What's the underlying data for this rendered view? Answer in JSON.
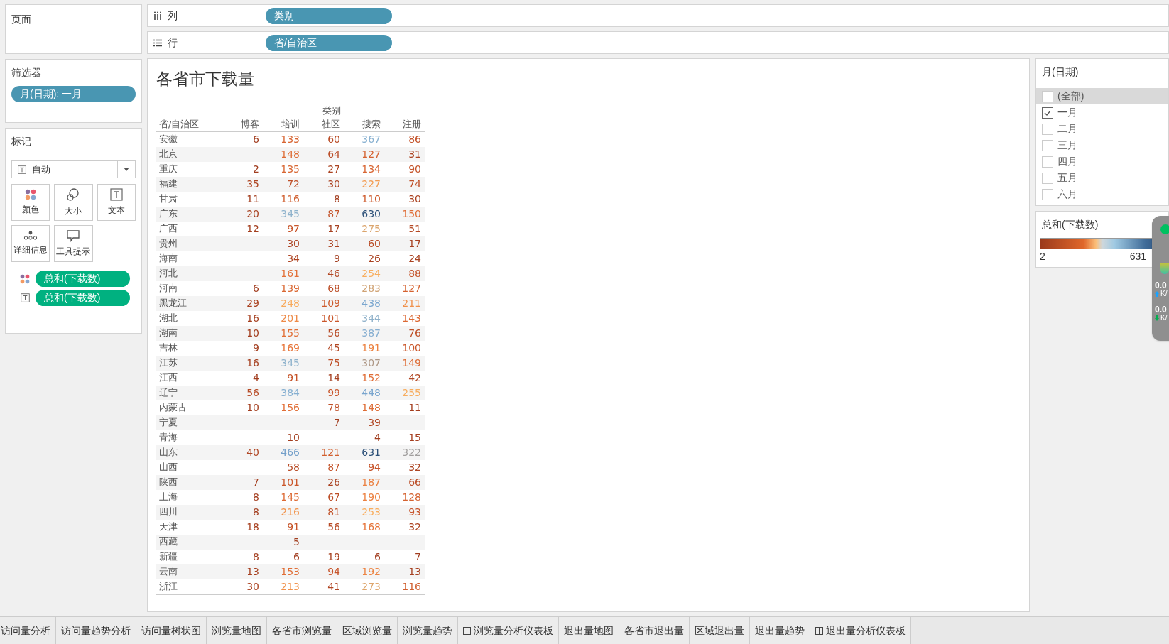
{
  "pages_card": {
    "title": "页面"
  },
  "shelves": [
    {
      "kind": "columns",
      "label": "列",
      "pill": "类别"
    },
    {
      "kind": "rows",
      "label": "行",
      "pill": "省/自治区"
    }
  ],
  "filters_card": {
    "title": "筛选器",
    "pills": [
      "月(日期): 一月"
    ]
  },
  "marks_card": {
    "title": "标记",
    "mark_type": "自动",
    "buttons": [
      {
        "kind": "color",
        "label": "颜色"
      },
      {
        "kind": "size",
        "label": "大小"
      },
      {
        "kind": "text",
        "label": "文本"
      },
      {
        "kind": "detail",
        "label": "详细信息"
      },
      {
        "kind": "tooltip",
        "label": "工具提示"
      }
    ],
    "pills": [
      {
        "kind": "color",
        "label": "总和(下载数)"
      },
      {
        "kind": "text",
        "label": "总和(下载数)"
      }
    ]
  },
  "view": {
    "title": "各省市下载量",
    "column_group": "类别",
    "row_header": "省/自治区",
    "columns": [
      "博客",
      "培训",
      "社区",
      "搜索",
      "注册"
    ],
    "rows": [
      {
        "name": "安徽",
        "values": [
          {
            "value": "6"
          },
          {
            "value": "133"
          },
          {
            "value": "60"
          },
          {
            "value": "367"
          },
          {
            "value": "86"
          }
        ]
      },
      {
        "name": "北京",
        "values": [
          {
            "empty": true
          },
          {
            "value": "148"
          },
          {
            "value": "64"
          },
          {
            "value": "127"
          },
          {
            "value": "31"
          }
        ]
      },
      {
        "name": "重庆",
        "values": [
          {
            "value": "2"
          },
          {
            "value": "135"
          },
          {
            "value": "27"
          },
          {
            "value": "134"
          },
          {
            "value": "90"
          }
        ]
      },
      {
        "name": "福建",
        "values": [
          {
            "value": "35"
          },
          {
            "value": "72"
          },
          {
            "value": "30"
          },
          {
            "value": "227"
          },
          {
            "value": "74"
          }
        ]
      },
      {
        "name": "甘肃",
        "values": [
          {
            "value": "11"
          },
          {
            "value": "116"
          },
          {
            "value": "8"
          },
          {
            "value": "110"
          },
          {
            "value": "30"
          }
        ]
      },
      {
        "name": "广东",
        "values": [
          {
            "value": "20"
          },
          {
            "value": "345"
          },
          {
            "value": "87"
          },
          {
            "value": "630"
          },
          {
            "value": "150"
          }
        ]
      },
      {
        "name": "广西",
        "values": [
          {
            "value": "12"
          },
          {
            "value": "97"
          },
          {
            "value": "17"
          },
          {
            "value": "275"
          },
          {
            "value": "51"
          }
        ]
      },
      {
        "name": "贵州",
        "values": [
          {
            "empty": true
          },
          {
            "value": "30"
          },
          {
            "value": "31"
          },
          {
            "value": "60"
          },
          {
            "value": "17"
          }
        ]
      },
      {
        "name": "海南",
        "values": [
          {
            "empty": true
          },
          {
            "value": "34"
          },
          {
            "value": "9"
          },
          {
            "value": "26"
          },
          {
            "value": "24"
          }
        ]
      },
      {
        "name": "河北",
        "values": [
          {
            "empty": true
          },
          {
            "value": "161"
          },
          {
            "value": "46"
          },
          {
            "value": "254"
          },
          {
            "value": "88"
          }
        ]
      },
      {
        "name": "河南",
        "values": [
          {
            "value": "6"
          },
          {
            "value": "139"
          },
          {
            "value": "68"
          },
          {
            "value": "283"
          },
          {
            "value": "127"
          }
        ]
      },
      {
        "name": "黑龙江",
        "values": [
          {
            "value": "29"
          },
          {
            "value": "248"
          },
          {
            "value": "109"
          },
          {
            "value": "438"
          },
          {
            "value": "211"
          }
        ]
      },
      {
        "name": "湖北",
        "values": [
          {
            "value": "16"
          },
          {
            "value": "201"
          },
          {
            "value": "101"
          },
          {
            "value": "344"
          },
          {
            "value": "143"
          }
        ]
      },
      {
        "name": "湖南",
        "values": [
          {
            "value": "10"
          },
          {
            "value": "155"
          },
          {
            "value": "56"
          },
          {
            "value": "387"
          },
          {
            "value": "76"
          }
        ]
      },
      {
        "name": "吉林",
        "values": [
          {
            "value": "9"
          },
          {
            "value": "169"
          },
          {
            "value": "45"
          },
          {
            "value": "191"
          },
          {
            "value": "100"
          }
        ]
      },
      {
        "name": "江苏",
        "values": [
          {
            "value": "16"
          },
          {
            "value": "345"
          },
          {
            "value": "75"
          },
          {
            "value": "307"
          },
          {
            "value": "149"
          }
        ]
      },
      {
        "name": "江西",
        "values": [
          {
            "value": "4"
          },
          {
            "value": "91"
          },
          {
            "value": "14"
          },
          {
            "value": "152"
          },
          {
            "value": "42"
          }
        ]
      },
      {
        "name": "辽宁",
        "values": [
          {
            "value": "56"
          },
          {
            "value": "384"
          },
          {
            "value": "99"
          },
          {
            "value": "448"
          },
          {
            "value": "255"
          }
        ]
      },
      {
        "name": "内蒙古",
        "values": [
          {
            "value": "10"
          },
          {
            "value": "156"
          },
          {
            "value": "78"
          },
          {
            "value": "148"
          },
          {
            "value": "11"
          }
        ]
      },
      {
        "name": "宁夏",
        "values": [
          {
            "empty": true
          },
          {
            "empty": true
          },
          {
            "value": "7"
          },
          {
            "value": "39"
          },
          {
            "empty": true
          }
        ]
      },
      {
        "name": "青海",
        "values": [
          {
            "empty": true
          },
          {
            "value": "10"
          },
          {
            "empty": true
          },
          {
            "value": "4"
          },
          {
            "value": "15"
          }
        ]
      },
      {
        "name": "山东",
        "values": [
          {
            "value": "40"
          },
          {
            "value": "466"
          },
          {
            "value": "121"
          },
          {
            "value": "631"
          },
          {
            "value": "322"
          }
        ]
      },
      {
        "name": "山西",
        "values": [
          {
            "empty": true
          },
          {
            "value": "58"
          },
          {
            "value": "87"
          },
          {
            "value": "94"
          },
          {
            "value": "32"
          }
        ]
      },
      {
        "name": "陕西",
        "values": [
          {
            "value": "7"
          },
          {
            "value": "101"
          },
          {
            "value": "26"
          },
          {
            "value": "187"
          },
          {
            "value": "66"
          }
        ]
      },
      {
        "name": "上海",
        "values": [
          {
            "value": "8"
          },
          {
            "value": "145"
          },
          {
            "value": "67"
          },
          {
            "value": "190"
          },
          {
            "value": "128"
          }
        ]
      },
      {
        "name": "四川",
        "values": [
          {
            "value": "8"
          },
          {
            "value": "216"
          },
          {
            "value": "81"
          },
          {
            "value": "253"
          },
          {
            "value": "93"
          }
        ]
      },
      {
        "name": "天津",
        "values": [
          {
            "value": "18"
          },
          {
            "value": "91"
          },
          {
            "value": "56"
          },
          {
            "value": "168"
          },
          {
            "value": "32"
          }
        ]
      },
      {
        "name": "西藏",
        "values": [
          {
            "empty": true
          },
          {
            "value": "5"
          },
          {
            "empty": true
          },
          {
            "empty": true
          },
          {
            "empty": true
          }
        ]
      },
      {
        "name": "新疆",
        "values": [
          {
            "value": "8"
          },
          {
            "value": "6"
          },
          {
            "value": "19"
          },
          {
            "value": "6"
          },
          {
            "value": "7"
          }
        ]
      },
      {
        "name": "云南",
        "values": [
          {
            "value": "13"
          },
          {
            "value": "153"
          },
          {
            "value": "94"
          },
          {
            "value": "192"
          },
          {
            "value": "13"
          }
        ]
      },
      {
        "name": "浙江",
        "values": [
          {
            "value": "30"
          },
          {
            "value": "213"
          },
          {
            "value": "41"
          },
          {
            "value": "273"
          },
          {
            "value": "116"
          }
        ]
      }
    ]
  },
  "month_filter": {
    "title": "月(日期)",
    "items": [
      {
        "label": "(全部)",
        "checked": false,
        "highlighted": true
      },
      {
        "label": "一月",
        "checked": true,
        "highlighted": false
      },
      {
        "label": "二月",
        "checked": false,
        "highlighted": false
      },
      {
        "label": "三月",
        "checked": false,
        "highlighted": false
      },
      {
        "label": "四月",
        "checked": false,
        "highlighted": false
      },
      {
        "label": "五月",
        "checked": false,
        "highlighted": false
      },
      {
        "label": "六月",
        "checked": false,
        "highlighted": false
      }
    ]
  },
  "color_legend": {
    "title": "总和(下载数)",
    "min": "2",
    "max": "631"
  },
  "speed_widget": {
    "readings": [
      {
        "kind": "up",
        "value": "0.0",
        "unit": "K/"
      },
      {
        "kind": "down",
        "value": "0.0",
        "unit": "K/"
      }
    ]
  },
  "sheet_tabs": [
    {
      "label": "访问量分析",
      "kind": "sheet",
      "selected": false
    },
    {
      "label": "访问量趋势分析",
      "kind": "sheet",
      "selected": false
    },
    {
      "label": "访问量树状图",
      "kind": "sheet",
      "selected": false
    },
    {
      "label": "浏览量地图",
      "kind": "sheet",
      "selected": false
    },
    {
      "label": "各省市浏览量",
      "kind": "sheet",
      "selected": false
    },
    {
      "label": "区域浏览量",
      "kind": "sheet",
      "selected": false
    },
    {
      "label": "浏览量趋势",
      "kind": "sheet",
      "selected": false
    },
    {
      "label": "浏览量分析仪表板",
      "kind": "dashboard",
      "selected": false
    },
    {
      "label": "退出量地图",
      "kind": "sheet",
      "selected": false
    },
    {
      "label": "各省市退出量",
      "kind": "sheet",
      "selected": false
    },
    {
      "label": "区域退出量",
      "kind": "sheet",
      "selected": false
    },
    {
      "label": "退出量趋势",
      "kind": "sheet",
      "selected": false
    },
    {
      "label": "退出量分析仪表板",
      "kind": "dashboard",
      "selected": false
    }
  ]
}
